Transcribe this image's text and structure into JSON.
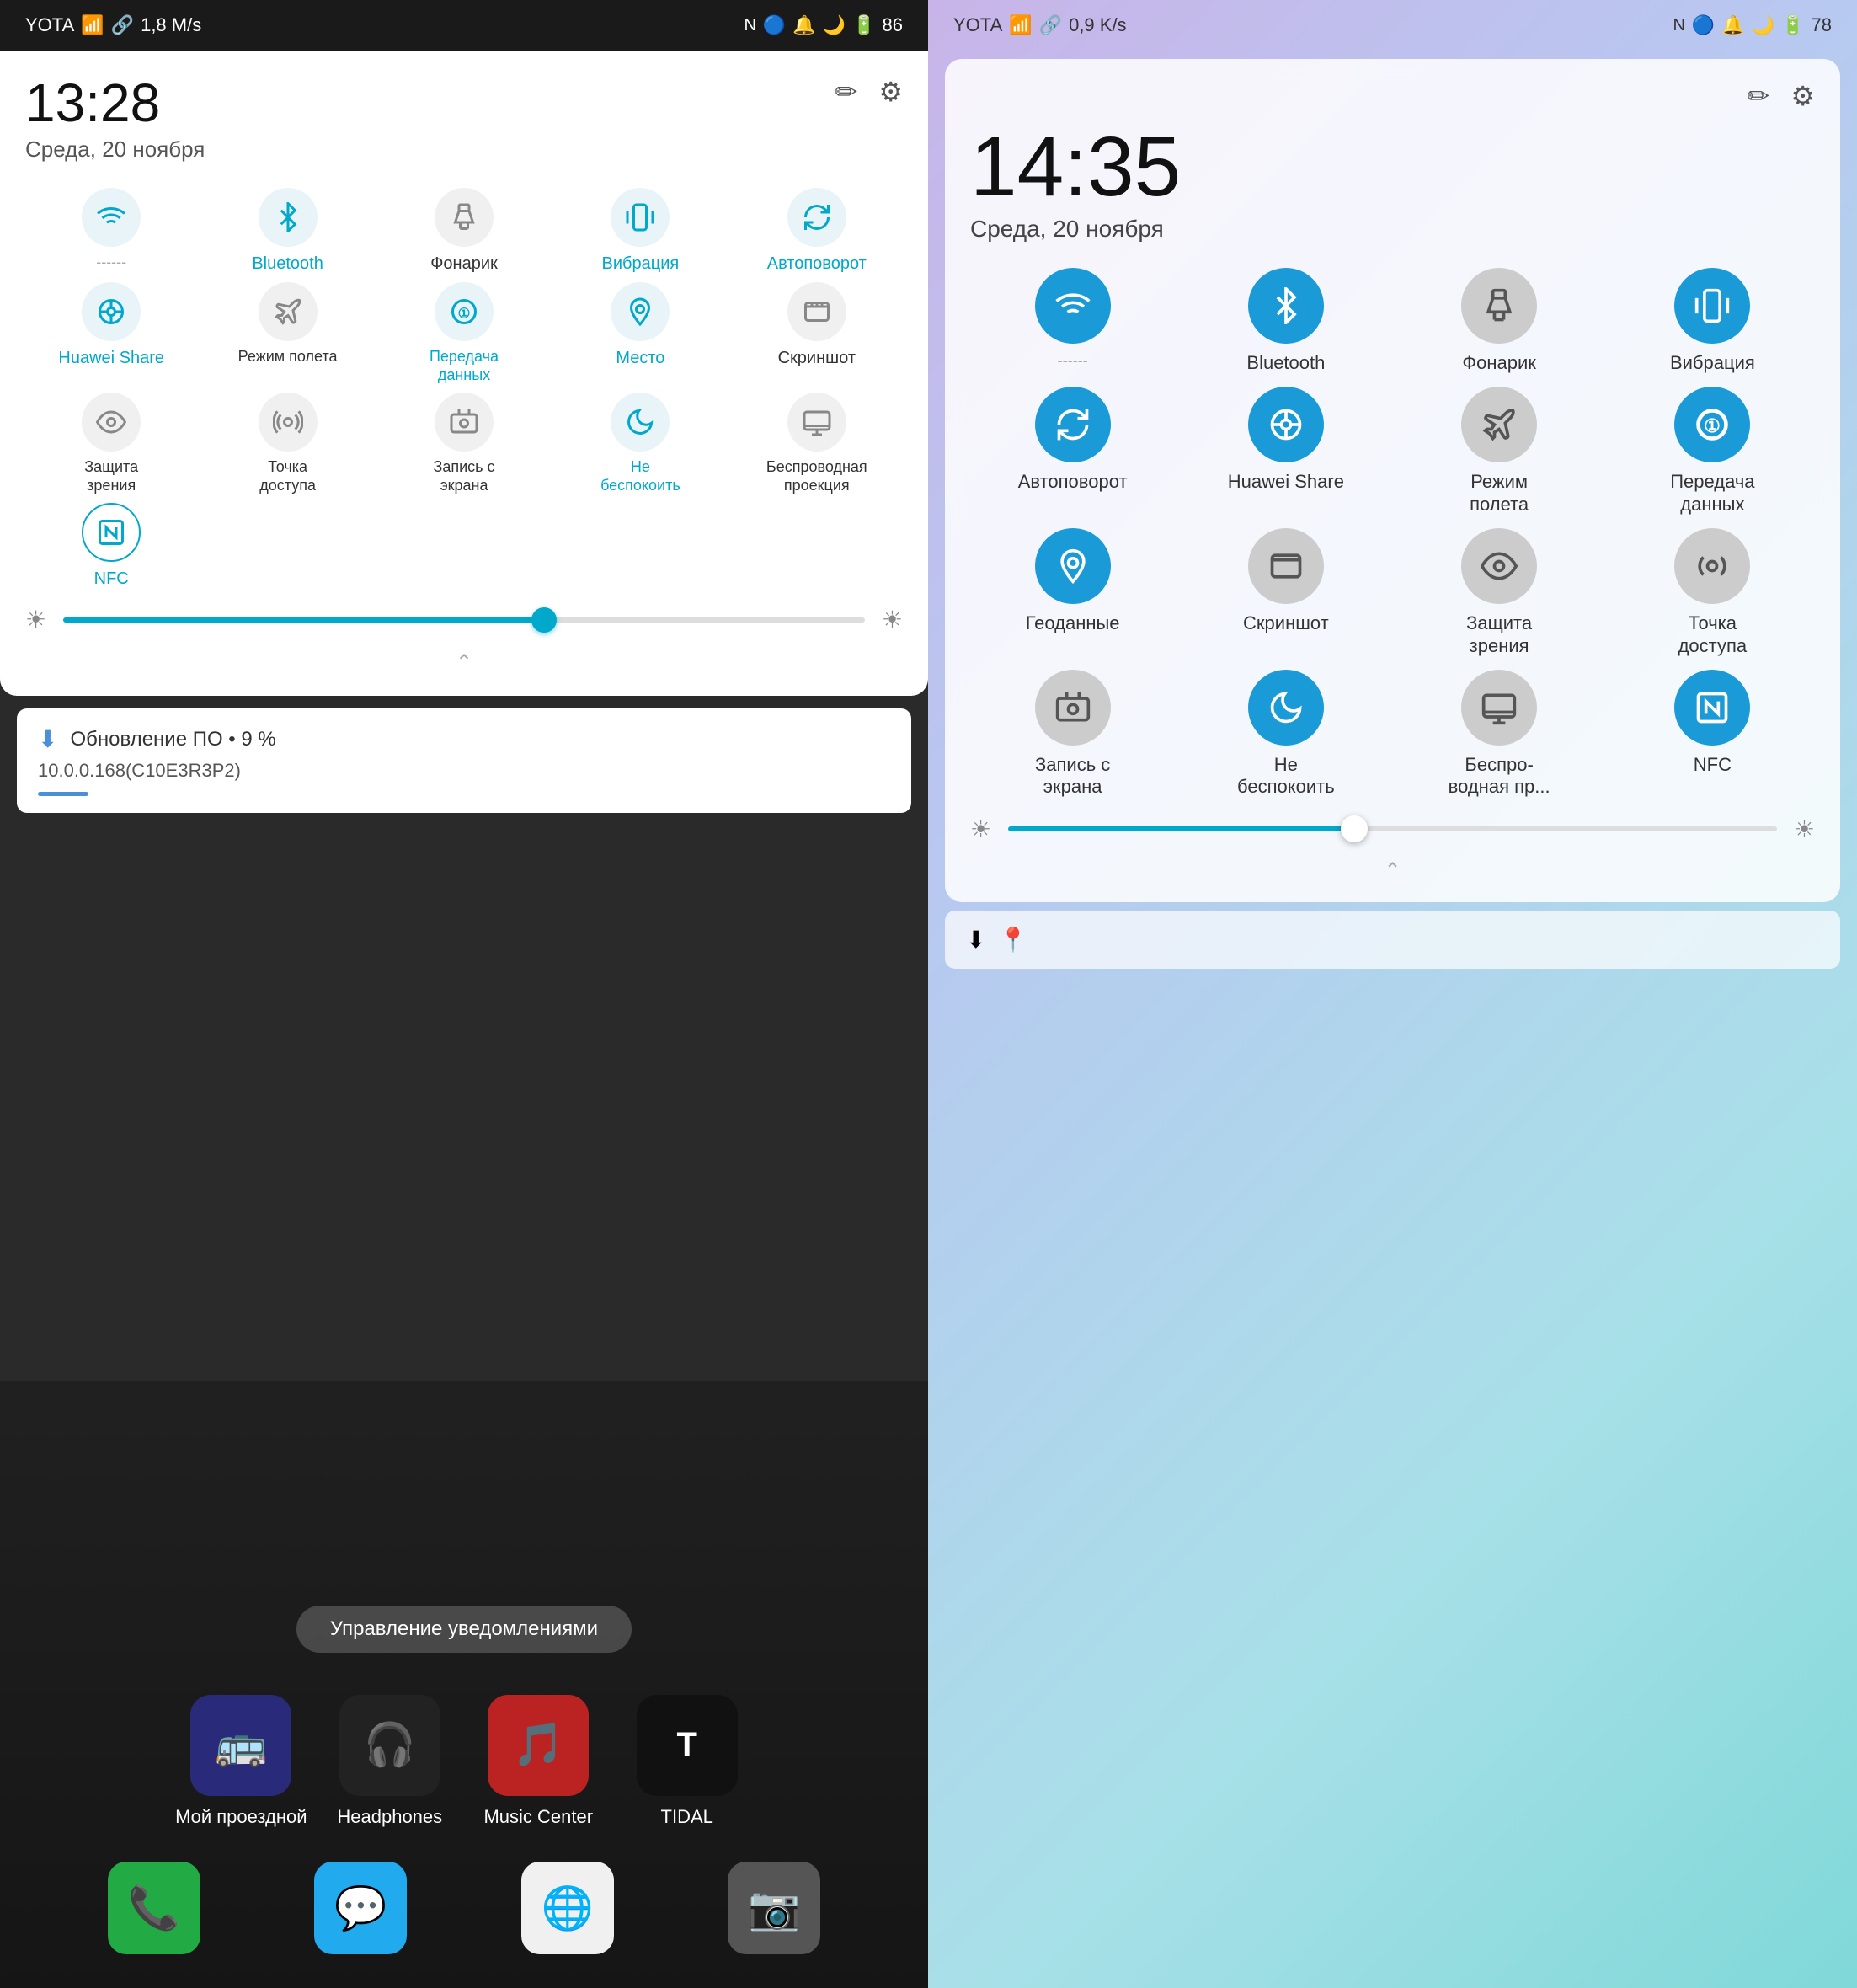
{
  "left": {
    "statusBar": {
      "carrier": "YOTA",
      "signal": "▌▌▌",
      "wifi": "wifi",
      "speed": "1,8 M/s",
      "nfc": "N",
      "bluetooth": "bluetooth",
      "alarm": "alarm",
      "doNotDisturb": "moon",
      "battery": "86"
    },
    "time": "13:28",
    "date": "Среда, 20 ноября",
    "editIcon": "✏",
    "settingsIcon": "⚙",
    "toggles": [
      {
        "id": "wifi",
        "label": "Wi-Fi",
        "active": true,
        "icon": "wifi"
      },
      {
        "id": "bluetooth",
        "label": "Bluetooth",
        "active": true,
        "icon": "bluetooth"
      },
      {
        "id": "flashlight",
        "label": "Фонарик",
        "active": false,
        "icon": "flashlight"
      },
      {
        "id": "vibration",
        "label": "Вибрация",
        "active": true,
        "icon": "vibration"
      },
      {
        "id": "autorotate",
        "label": "Автоповорот",
        "active": true,
        "icon": "rotate"
      },
      {
        "id": "huaweishare",
        "label": "Huawei Share",
        "active": true,
        "icon": "share"
      },
      {
        "id": "airplane",
        "label": "Режим полета",
        "active": false,
        "icon": "airplane"
      },
      {
        "id": "datatransfer",
        "label": "Передача данных",
        "active": true,
        "icon": "data"
      },
      {
        "id": "location",
        "label": "Место",
        "active": true,
        "icon": "location"
      },
      {
        "id": "screenshot",
        "label": "Скриншот",
        "active": false,
        "icon": "screenshot"
      },
      {
        "id": "eyeprotect",
        "label": "Защита зрения",
        "active": false,
        "icon": "eye"
      },
      {
        "id": "hotspot",
        "label": "Точка доступа",
        "active": false,
        "icon": "hotspot"
      },
      {
        "id": "screenrecord",
        "label": "Запись с экрана",
        "active": false,
        "icon": "record"
      },
      {
        "id": "donotdisturb",
        "label": "Не беспокоить",
        "active": true,
        "icon": "moon"
      },
      {
        "id": "wirelessprojection",
        "label": "Беспроводная проекция",
        "active": false,
        "icon": "projection"
      },
      {
        "id": "nfc",
        "label": "NFC",
        "active": true,
        "icon": "nfc"
      }
    ],
    "notification": {
      "icon": "⬇",
      "title": "Обновление ПО • 9 %",
      "subtitle": "10.0.0.168(C10E3R3P2)"
    },
    "manageNotif": "Управление уведомлениями",
    "apps": [
      {
        "id": "mytravel",
        "label": "Мой проездной",
        "color": "#3a3a9a",
        "icon": "🚌"
      },
      {
        "id": "headphones",
        "label": "Headphones",
        "color": "#333",
        "icon": "🎧"
      },
      {
        "id": "musiccenter",
        "label": "Music Center",
        "color": "#cc3333",
        "icon": "🎵"
      },
      {
        "id": "tidal",
        "label": "TIDAL",
        "color": "#111",
        "icon": "🎵"
      }
    ],
    "dock": [
      {
        "id": "phone",
        "color": "#22aa44",
        "icon": "📞"
      },
      {
        "id": "messages",
        "color": "#22aaee",
        "icon": "💬"
      },
      {
        "id": "chrome",
        "color": "#44aa44",
        "icon": "🌐"
      },
      {
        "id": "camera",
        "color": "#666666",
        "icon": "📷"
      }
    ]
  },
  "right": {
    "statusBar": {
      "carrier": "YOTA",
      "signal": "▌▌▌",
      "wifi": "wifi",
      "speed": "0,9 K/s",
      "nfc": "N",
      "bluetooth": "bluetooth",
      "alarm": "alarm",
      "doNotDisturb": "moon",
      "battery": "78"
    },
    "time": "14:35",
    "date": "Среда, 20 ноября",
    "editIcon": "✏",
    "settingsIcon": "⚙",
    "toggles": [
      {
        "id": "wifi",
        "label": "Wi-Fi",
        "active": true,
        "icon": "wifi"
      },
      {
        "id": "bluetooth",
        "label": "Bluetooth",
        "active": true,
        "icon": "bluetooth"
      },
      {
        "id": "flashlight",
        "label": "Фонарик",
        "active": false,
        "icon": "flashlight"
      },
      {
        "id": "vibration",
        "label": "Вибрация",
        "active": true,
        "icon": "vibration"
      },
      {
        "id": "autorotate",
        "label": "Автоповорот",
        "active": true,
        "icon": "rotate"
      },
      {
        "id": "huaweishare",
        "label": "Huawei Share",
        "active": true,
        "icon": "share"
      },
      {
        "id": "airplane",
        "label": "Режим полета",
        "active": false,
        "icon": "airplane"
      },
      {
        "id": "datatransfer",
        "label": "Передача данных",
        "active": true,
        "icon": "data"
      },
      {
        "id": "geodata",
        "label": "Геоданные",
        "active": true,
        "icon": "location"
      },
      {
        "id": "screenshot",
        "label": "Скриншот",
        "active": false,
        "icon": "screenshot"
      },
      {
        "id": "eyeprotect",
        "label": "Защита зрения",
        "active": false,
        "icon": "eye"
      },
      {
        "id": "hotspot",
        "label": "Точка доступа",
        "active": false,
        "icon": "hotspot"
      },
      {
        "id": "screenrecord",
        "label": "Запись с экрана",
        "active": false,
        "icon": "record"
      },
      {
        "id": "donotdisturb",
        "label": "Не беспокоить",
        "active": true,
        "icon": "moon"
      },
      {
        "id": "wirelessprojection",
        "label": "Беспро-\nводная пр...",
        "active": false,
        "icon": "projection"
      },
      {
        "id": "nfc",
        "label": "NFC",
        "active": true,
        "icon": "nfc"
      }
    ],
    "notification": {
      "downloadIcon": "⬇",
      "locationIcon": "📍",
      "text": ""
    }
  }
}
